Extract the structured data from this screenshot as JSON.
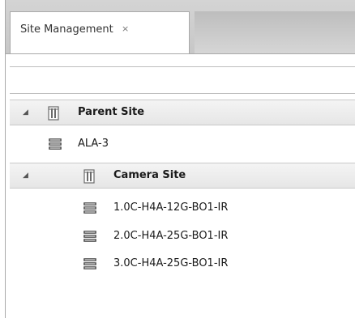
{
  "tab": {
    "title": "Site Management",
    "close_glyph": "×"
  },
  "tree": {
    "parent_site": {
      "label": "Parent Site",
      "expand_glyph": "◢",
      "icon": "building-icon"
    },
    "ala_item": {
      "label": "ALA-3",
      "icon": "server-icon"
    },
    "camera_site": {
      "label": "Camera Site",
      "expand_glyph": "◢",
      "icon": "building-icon"
    },
    "cameras": [
      {
        "label": "1.0C-H4A-12G-BO1-IR",
        "icon": "server-icon"
      },
      {
        "label": "2.0C-H4A-25G-BO1-IR",
        "icon": "server-icon"
      },
      {
        "label": "3.0C-H4A-25G-BO1-IR",
        "icon": "server-icon"
      }
    ]
  },
  "colors": {
    "tab_strip": "#d0d0d0",
    "group_row": "#ececec",
    "icon_gray": "#6b6b6b"
  }
}
